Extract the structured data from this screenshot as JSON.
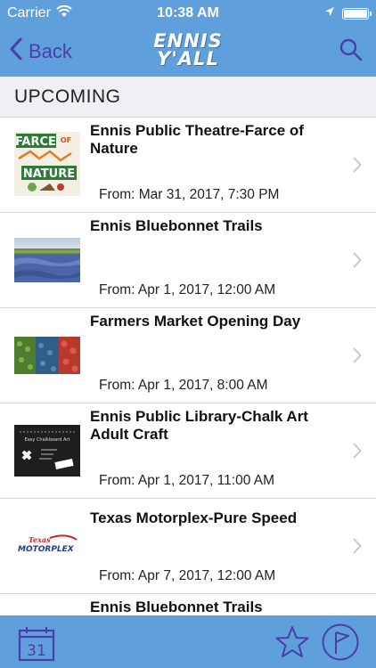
{
  "status_bar": {
    "carrier": "Carrier",
    "time": "10:38 AM",
    "icons": [
      "wifi-icon",
      "location-arrow-icon",
      "battery-icon"
    ]
  },
  "nav": {
    "back_label": "Back",
    "logo_line1": "ENNIS",
    "logo_line2": "Y'ALL",
    "search_icon": "search-icon",
    "accent_color": "#4a3fa8",
    "bar_color": "#5f9fdc"
  },
  "section": {
    "title": "UPCOMING"
  },
  "events": [
    {
      "title": "Ennis Public Theatre-Farce of Nature",
      "date": "From: Mar 31, 2017, 7:30 PM",
      "thumb": "farce-of-nature-poster"
    },
    {
      "title": "Ennis Bluebonnet Trails",
      "date": "From: Apr 1, 2017, 12:00 AM",
      "thumb": "bluebonnet-field-photo"
    },
    {
      "title": "Farmers Market Opening Day",
      "date": "From: Apr 1, 2017, 8:00 AM",
      "thumb": "produce-market-photo"
    },
    {
      "title": "Ennis Public Library-Chalk Art Adult Craft",
      "date": "From: Apr 1, 2017, 11:00 AM",
      "thumb": "chalkboard-flyer"
    },
    {
      "title": "Texas Motorplex-Pure Speed",
      "date": "From: Apr 7, 2017, 12:00 AM",
      "thumb": "texas-motorplex-logo"
    },
    {
      "title": "Ennis Bluebonnet Trails",
      "date": "",
      "thumb": ""
    }
  ],
  "thumb_text": {
    "farce_line1": "FARCE",
    "farce_of": "OF",
    "farce_line2": "NATURE",
    "chalk_line": "Easy Chalkboard Art",
    "motorplex_texas": "Texas",
    "motorplex_name": "MOTORPLEX"
  },
  "tab_bar": {
    "calendar_day": "31",
    "icons": [
      "calendar-icon",
      "star-icon",
      "flag-icon"
    ]
  }
}
